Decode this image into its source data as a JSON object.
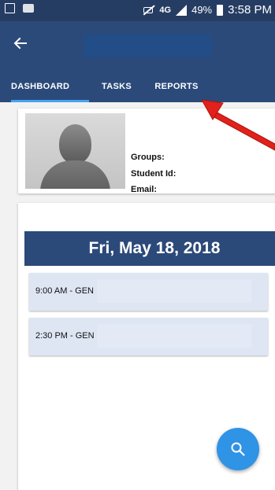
{
  "status_bar": {
    "network": "4G",
    "battery_percent": "49%",
    "time": "3:58 PM"
  },
  "app_bar": {
    "back_icon": "arrow-left-icon",
    "tabs": [
      {
        "label": "DASHBOARD",
        "selected": true
      },
      {
        "label": "TASKS",
        "selected": false
      },
      {
        "label": "REPORTS",
        "selected": false
      }
    ]
  },
  "profile": {
    "avatar_icon": "default-avatar",
    "groups_label": "Groups:",
    "student_id_label": "Student Id:",
    "email_label": "Email:"
  },
  "schedule": {
    "date": "Fri, May 18, 2018",
    "appointments": [
      {
        "label": "9:00 AM - GEN"
      },
      {
        "label": "2:30 PM - GEN"
      }
    ]
  },
  "fab": {
    "icon": "search-icon"
  },
  "colors": {
    "primary": "#2b4a7a",
    "tab_indicator": "#46a3ee",
    "appointment_bg": "#dee6f4",
    "fab": "#2f93e6",
    "annotation_arrow": "#e0211c"
  }
}
